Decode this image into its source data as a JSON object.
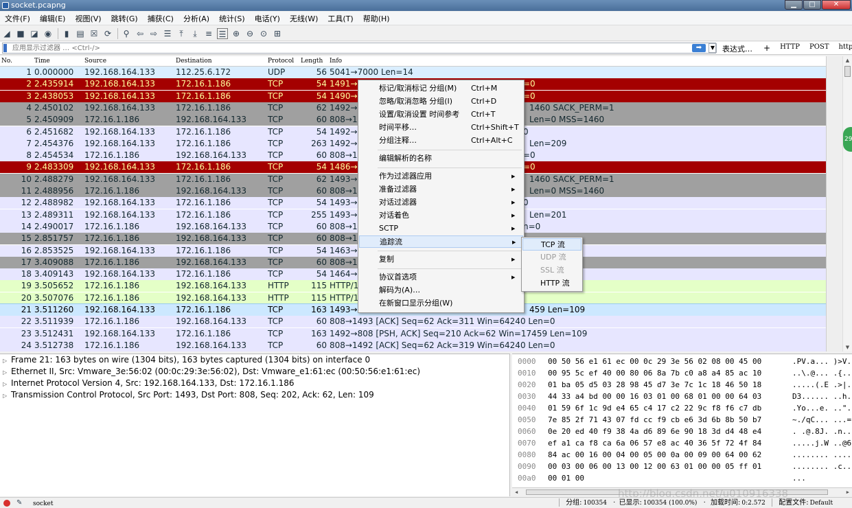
{
  "window": {
    "title": "socket.pcapng"
  },
  "menubar": [
    "文件(F)",
    "编辑(E)",
    "视图(V)",
    "跳转(G)",
    "捕获(C)",
    "分析(A)",
    "统计(S)",
    "电话(Y)",
    "无线(W)",
    "工具(T)",
    "帮助(H)"
  ],
  "filter": {
    "placeholder": "应用显示过滤器 … <Ctrl-/>",
    "expression_label": "表达式…",
    "plus_label": "+",
    "buttons": [
      "HTTP",
      "POST",
      "http"
    ]
  },
  "packet_list": {
    "headers": {
      "no": "No.",
      "time": "Time",
      "source": "Source",
      "destination": "Destination",
      "protocol": "Protocol",
      "length": "Length",
      "info": "Info"
    },
    "rows": [
      {
        "no": "1",
        "time": "0.000000",
        "src": "192.168.164.133",
        "dst": "112.25.6.172",
        "proto": "UDP",
        "len": "56",
        "info": "5041→7000 Len=14",
        "style": "udp"
      },
      {
        "no": "2",
        "time": "2.435914",
        "src": "192.168.164.133",
        "dst": "172.16.1.186",
        "proto": "TCP",
        "len": "54",
        "info": "1491→8",
        "tail": "=0",
        "style": "bad"
      },
      {
        "no": "3",
        "time": "2.438053",
        "src": "192.168.164.133",
        "dst": "172.16.1.186",
        "proto": "TCP",
        "len": "54",
        "info": "1490→8",
        "tail": "=0",
        "style": "bad"
      },
      {
        "no": "4",
        "time": "2.450102",
        "src": "192.168.164.133",
        "dst": "172.16.1.186",
        "proto": "TCP",
        "len": "62",
        "info": "1492→8",
        "tail": "1460 SACK_PERM=1",
        "style": "syn"
      },
      {
        "no": "5",
        "time": "2.450909",
        "src": "172.16.1.186",
        "dst": "192.168.164.133",
        "proto": "TCP",
        "len": "60",
        "info": "808→14",
        "tail": "Len=0 MSS=1460",
        "style": "syn"
      },
      {
        "no": "6",
        "time": "2.451682",
        "src": "192.168.164.133",
        "dst": "172.16.1.186",
        "proto": "TCP",
        "len": "54",
        "info": "1492→8",
        "tail": "0",
        "style": "tcp"
      },
      {
        "no": "7",
        "time": "2.454376",
        "src": "192.168.164.133",
        "dst": "172.16.1.186",
        "proto": "TCP",
        "len": "263",
        "info": "1492→8",
        "tail": "Len=209",
        "style": "tcp"
      },
      {
        "no": "8",
        "time": "2.454534",
        "src": "172.16.1.186",
        "dst": "192.168.164.133",
        "proto": "TCP",
        "len": "60",
        "info": "808→14",
        "tail": "=0",
        "style": "tcp"
      },
      {
        "no": "9",
        "time": "2.483309",
        "src": "192.168.164.133",
        "dst": "172.16.1.186",
        "proto": "TCP",
        "len": "54",
        "info": "1486→8",
        "tail": "=0",
        "style": "bad"
      },
      {
        "no": "10",
        "time": "2.488279",
        "src": "192.168.164.133",
        "dst": "172.16.1.186",
        "proto": "TCP",
        "len": "62",
        "info": "1493→8",
        "tail": "1460 SACK_PERM=1",
        "style": "syn"
      },
      {
        "no": "11",
        "time": "2.488956",
        "src": "172.16.1.186",
        "dst": "192.168.164.133",
        "proto": "TCP",
        "len": "60",
        "info": "808→14",
        "tail": "Len=0 MSS=1460",
        "style": "syn"
      },
      {
        "no": "12",
        "time": "2.488982",
        "src": "192.168.164.133",
        "dst": "172.16.1.186",
        "proto": "TCP",
        "len": "54",
        "info": "1493→8",
        "tail": "0",
        "style": "tcp"
      },
      {
        "no": "13",
        "time": "2.489311",
        "src": "192.168.164.133",
        "dst": "172.16.1.186",
        "proto": "TCP",
        "len": "255",
        "info": "1493→8",
        "tail": "Len=201",
        "style": "tcp"
      },
      {
        "no": "14",
        "time": "2.490017",
        "src": "172.16.1.186",
        "dst": "192.168.164.133",
        "proto": "TCP",
        "len": "60",
        "info": "808→14",
        "tail": "n=0",
        "style": "tcp"
      },
      {
        "no": "15",
        "time": "2.851757",
        "src": "172.16.1.186",
        "dst": "192.168.164.133",
        "proto": "TCP",
        "len": "60",
        "info": "808→14",
        "tail": "",
        "style": "syn"
      },
      {
        "no": "16",
        "time": "2.853525",
        "src": "192.168.164.133",
        "dst": "172.16.1.186",
        "proto": "TCP",
        "len": "54",
        "info": "1463→8",
        "tail": "",
        "style": "tcp"
      },
      {
        "no": "17",
        "time": "3.409088",
        "src": "172.16.1.186",
        "dst": "192.168.164.133",
        "proto": "TCP",
        "len": "60",
        "info": "808→14",
        "tail": "",
        "style": "syn"
      },
      {
        "no": "18",
        "time": "3.409143",
        "src": "192.168.164.133",
        "dst": "172.16.1.186",
        "proto": "TCP",
        "len": "54",
        "info": "1464→8",
        "tail": "",
        "style": "tcp"
      },
      {
        "no": "19",
        "time": "3.505652",
        "src": "172.16.1.186",
        "dst": "192.168.164.133",
        "proto": "HTTP",
        "len": "115",
        "info": "HTTP/1",
        "tail": "",
        "style": "http"
      },
      {
        "no": "20",
        "time": "3.507076",
        "src": "172.16.1.186",
        "dst": "192.168.164.133",
        "proto": "HTTP",
        "len": "115",
        "info": "HTTP/1",
        "tail": "",
        "style": "http"
      },
      {
        "no": "21",
        "time": "3.511260",
        "src": "192.168.164.133",
        "dst": "172.16.1.186",
        "proto": "TCP",
        "len": "163",
        "info": "1493→8",
        "tail": "459 Len=109",
        "style": "sel"
      },
      {
        "no": "22",
        "time": "3.511939",
        "src": "172.16.1.186",
        "dst": "192.168.164.133",
        "proto": "TCP",
        "len": "60",
        "info": "808→1493 [ACK] Seq=62 Ack=311 Win=64240 Len=0",
        "tail": "",
        "style": "tcp"
      },
      {
        "no": "23",
        "time": "3.512431",
        "src": "192.168.164.133",
        "dst": "172.16.1.186",
        "proto": "TCP",
        "len": "163",
        "info": "1492→808 [PSH, ACK] Seq=210 Ack=62 Win=17459 Len=109",
        "tail": "",
        "style": "tcp"
      },
      {
        "no": "24",
        "time": "3.512738",
        "src": "172.16.1.186",
        "dst": "192.168.164.133",
        "proto": "TCP",
        "len": "60",
        "info": "808→1492 [ACK] Seq=62 Ack=319 Win=64240 Len=0",
        "tail": "",
        "style": "tcp"
      }
    ]
  },
  "minimap_badge": "29",
  "details": [
    "Frame 21: 163 bytes on wire (1304 bits), 163 bytes captured (1304 bits) on interface 0",
    "Ethernet II, Src: Vmware_3e:56:02 (00:0c:29:3e:56:02), Dst: Vmware_e1:61:ec (00:50:56:e1:61:ec)",
    "Internet Protocol Version 4, Src: 192.168.164.133, Dst: 172.16.1.186",
    "Transmission Control Protocol, Src Port: 1493, Dst Port: 808, Seq: 202, Ack: 62, Len: 109"
  ],
  "bytes": [
    {
      "off": "0000",
      "hex": "00 50 56 e1 61 ec 00 0c  29 3e 56 02 08 00 45 00",
      "ascii": ".PV.a... )>V."
    },
    {
      "off": "0010",
      "hex": "00 95 5c ef 40 00 80 06  8a 7b c0 a8 a4 85 ac 10",
      "ascii": "..\\.@... .{.."
    },
    {
      "off": "0020",
      "hex": "01 ba 05 d5 03 28 98 45  d7 3e 7c 1c 18 46 50 18",
      "ascii": ".....(.E .>|."
    },
    {
      "off": "0030",
      "hex": "44 33 a4 bd 00 00 16 03  01 00 68 01 00 00 64 03",
      "ascii": "D3...... ..h."
    },
    {
      "off": "0040",
      "hex": "01 59 6f 1c 9d e4 65 c4  17 c2 22 9c f8 f6 c7 db",
      "ascii": ".Yo...e. ..\"."
    },
    {
      "off": "0050",
      "hex": "7e 85 2f 71 43 07 fd cc  f9 cb e6 3d 6b 8b 50 b7",
      "ascii": "~./qC... ...="
    },
    {
      "off": "0060",
      "hex": "0e 20 ed 40 f9 38 4a d6  89 6e 90 18 3d d4 48 e4",
      "ascii": ". .@.8J. .n.."
    },
    {
      "off": "0070",
      "hex": "ef a1 ca f8 ca 6a 06 57  e8 ac 40 36 5f 72 4f 84",
      "ascii": ".....j.W ..@6"
    },
    {
      "off": "0080",
      "hex": "84 ac 00 16 00 04 00 05  00 0a 00 09 00 64 00 62",
      "ascii": "........ ....."
    },
    {
      "off": "0090",
      "hex": "00 03 00 06 00 13 00 12  00 63 01 00 00 05 ff 01",
      "ascii": "........ .c.."
    },
    {
      "off": "00a0",
      "hex": "00 01 00",
      "ascii": "..."
    }
  ],
  "context_menu": {
    "items": [
      {
        "label": "标记/取消标记 分组(M)",
        "shortcut": "Ctrl+M",
        "arrow": false,
        "hover": false
      },
      {
        "label": "忽略/取消忽略 分组(I)",
        "shortcut": "Ctrl+D",
        "arrow": false,
        "hover": false
      },
      {
        "label": "设置/取消设置 时间参考",
        "shortcut": "Ctrl+T",
        "arrow": false,
        "hover": false
      },
      {
        "label": "时间平移…",
        "shortcut": "Ctrl+Shift+T",
        "arrow": false,
        "hover": false
      },
      {
        "label": "分组注释…",
        "shortcut": "Ctrl+Alt+C",
        "arrow": false,
        "hover": false
      },
      {
        "label": "编辑解析的名称",
        "shortcut": "",
        "arrow": false,
        "hover": false
      },
      {
        "label": "作为过滤器应用",
        "shortcut": "",
        "arrow": true,
        "hover": false
      },
      {
        "label": "准备过滤器",
        "shortcut": "",
        "arrow": true,
        "hover": false
      },
      {
        "label": "对话过滤器",
        "shortcut": "",
        "arrow": true,
        "hover": false
      },
      {
        "label": "对话着色",
        "shortcut": "",
        "arrow": true,
        "hover": false
      },
      {
        "label": "SCTP",
        "shortcut": "",
        "arrow": true,
        "hover": false
      },
      {
        "label": "追踪流",
        "shortcut": "",
        "arrow": true,
        "hover": true
      },
      {
        "label": "复制",
        "shortcut": "",
        "arrow": true,
        "hover": false
      },
      {
        "label": "协议首选项",
        "shortcut": "",
        "arrow": true,
        "hover": false
      },
      {
        "label": "解码为(A)…",
        "shortcut": "",
        "arrow": false,
        "hover": false
      },
      {
        "label": "在新窗口显示分组(W)",
        "shortcut": "",
        "arrow": false,
        "hover": false
      }
    ],
    "submenu": [
      {
        "label": "TCP 流",
        "disabled": false,
        "hover": true
      },
      {
        "label": "UDP 流",
        "disabled": true,
        "hover": false
      },
      {
        "label": "SSL 流",
        "disabled": true,
        "hover": false
      },
      {
        "label": "HTTP 流",
        "disabled": false,
        "hover": false
      }
    ]
  },
  "watermark": "http://blog.csdn.net/u010916338",
  "status": {
    "file": "socket",
    "packets_label": "分组:",
    "packets": "100354",
    "displayed_label": "已显示:",
    "displayed": "100354 (100.0%)",
    "load_label": "加载时间:",
    "load_time": "0:2.572",
    "profile_label": "配置文件:",
    "profile": "Default"
  }
}
